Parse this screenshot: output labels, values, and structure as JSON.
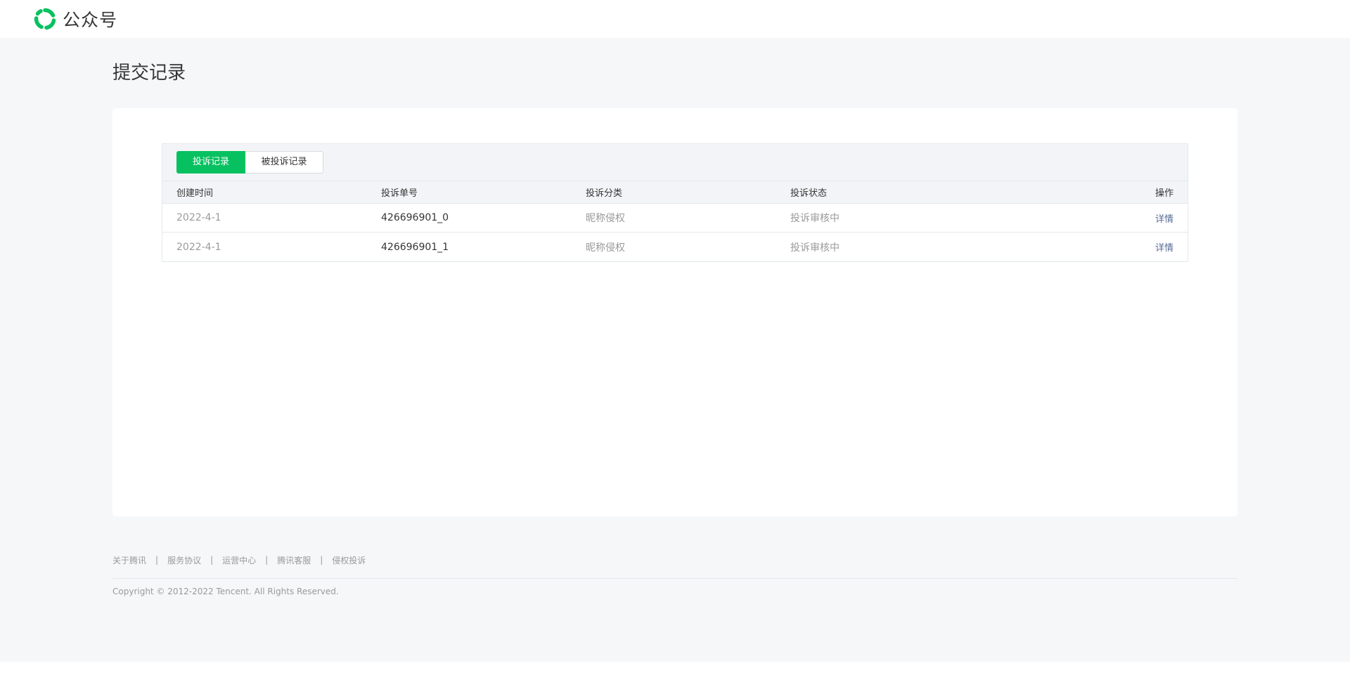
{
  "header": {
    "brand_name": "公众号",
    "logo_icon": "wechat-official-account-logo-icon",
    "brand_color": "#07c160"
  },
  "page": {
    "title": "提交记录"
  },
  "tabs": [
    {
      "label": "投诉记录",
      "active": true
    },
    {
      "label": "被投诉记录",
      "active": false
    }
  ],
  "table": {
    "columns": [
      "创建时间",
      "投诉单号",
      "投诉分类",
      "投诉状态",
      "操作"
    ],
    "rows": [
      {
        "date": "2022-4-1",
        "ticket": "426696901_0",
        "category": "昵称侵权",
        "status": "投诉审核中",
        "action": "详情"
      },
      {
        "date": "2022-4-1",
        "ticket": "426696901_1",
        "category": "昵称侵权",
        "status": "投诉审核中",
        "action": "详情"
      }
    ]
  },
  "footer": {
    "links": [
      "关于腾讯",
      "服务协议",
      "运营中心",
      "腾讯客服",
      "侵权投诉"
    ],
    "separator": "|",
    "copyright": "Copyright © 2012-2022 Tencent. All Rights Reserved."
  },
  "colors": {
    "accent": "#07c160",
    "link": "#576b95",
    "page_bg": "#f6f7f9"
  }
}
